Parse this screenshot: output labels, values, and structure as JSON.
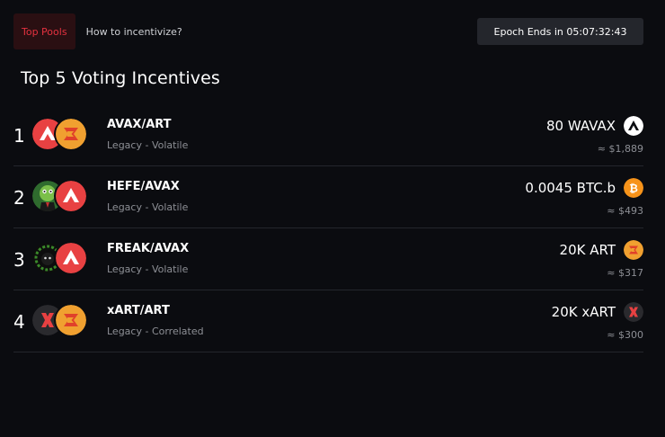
{
  "tabs": [
    {
      "label": "Top Pools",
      "active": true
    },
    {
      "label": "How to incentivize?",
      "active": false
    }
  ],
  "epoch": {
    "label": "Epoch Ends in 05:07:32:43"
  },
  "title": "Top 5 Voting Incentives",
  "rows": [
    {
      "rank": "1",
      "pair": "AVAX/ART",
      "type": "Legacy - Volatile",
      "reward": "80 WAVAX",
      "usd": "≈ $1,889",
      "icons": [
        "avax-icon",
        "art-icon"
      ],
      "reward_icon": "wavax-icon"
    },
    {
      "rank": "2",
      "pair": "HEFE/AVAX",
      "type": "Legacy - Volatile",
      "reward": "0.0045 BTC.b",
      "usd": "≈ $493",
      "icons": [
        "hefe-icon",
        "avax-icon"
      ],
      "reward_icon": "btc-icon"
    },
    {
      "rank": "3",
      "pair": "FREAK/AVAX",
      "type": "Legacy - Volatile",
      "reward": "20K ART",
      "usd": "≈ $317",
      "icons": [
        "freak-icon",
        "avax-icon"
      ],
      "reward_icon": "art-icon"
    },
    {
      "rank": "4",
      "pair": "xART/ART",
      "type": "Legacy - Correlated",
      "reward": "20K xART",
      "usd": "≈ $300",
      "icons": [
        "xart-icon",
        "art-icon"
      ],
      "reward_icon": "xart-icon"
    }
  ],
  "colors": {
    "background": "#0b0c10",
    "accent": "#e4313f",
    "avax": "#e84142",
    "art": "#f0a030",
    "btc": "#f7931a",
    "muted": "#8d8f95"
  }
}
